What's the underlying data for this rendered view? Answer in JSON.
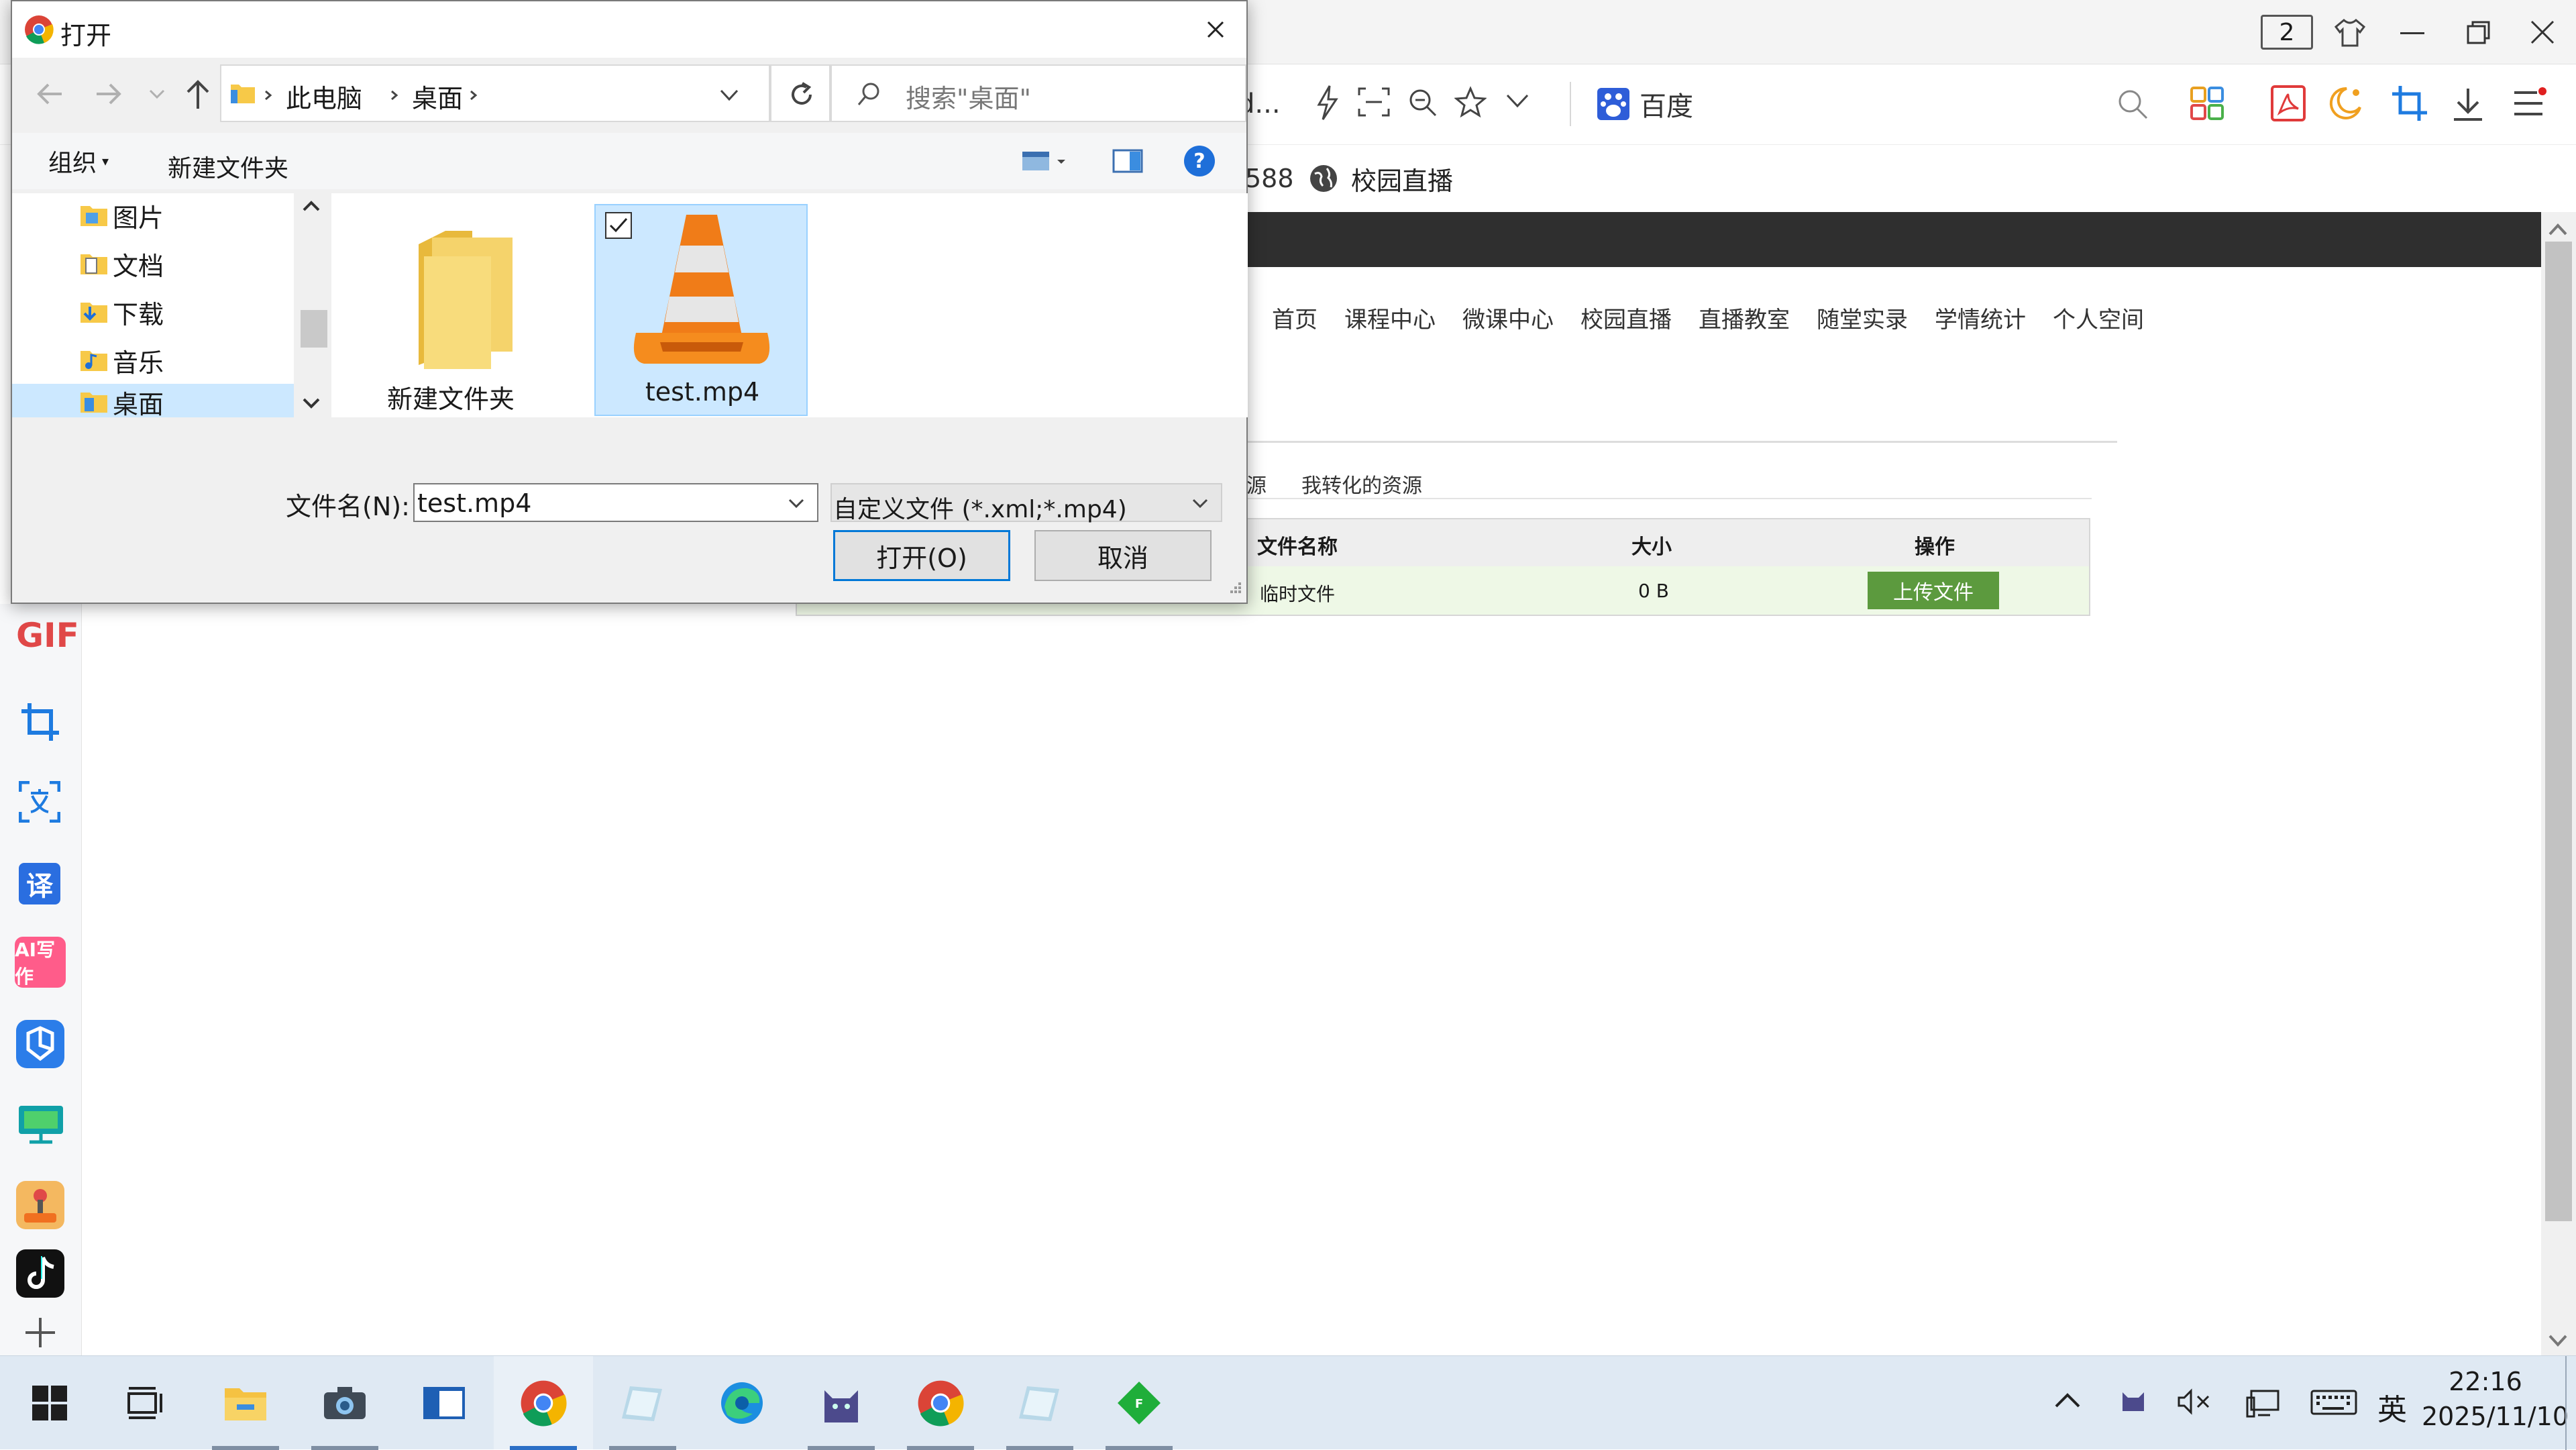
{
  "browser": {
    "tab_count": "2",
    "toolbar_trunc": "d...",
    "search_engine": "百度",
    "bookmarks": {
      "trunc_num": "588",
      "item": "校园直播"
    }
  },
  "site": {
    "nav": [
      "首页",
      "课程中心",
      "微课中心",
      "校园直播",
      "直播教室",
      "随堂实录",
      "学情统计",
      "个人空间"
    ],
    "subtabs": {
      "trunc": "源",
      "converted": "我转化的资源"
    },
    "table": {
      "headers": {
        "name": "文件名称",
        "size": "大小",
        "action": "操作"
      },
      "row": {
        "name": "临时文件",
        "size": "0 B",
        "action": "上传文件"
      }
    }
  },
  "sidebar_tools": [
    "GIF",
    "crop",
    "ocr",
    "译",
    "AI写作",
    "app",
    "screen",
    "game",
    "tiktok",
    "+"
  ],
  "dialog": {
    "title": "打开",
    "breadcrumb": [
      "此电脑",
      "桌面"
    ],
    "search_placeholder": "搜索\"桌面\"",
    "organize": "组织",
    "new_folder": "新建文件夹",
    "tree": [
      "图片",
      "文档",
      "下载",
      "音乐",
      "桌面"
    ],
    "files": [
      {
        "name": "新建文件夹",
        "kind": "folder"
      },
      {
        "name": "test.mp4",
        "kind": "video"
      }
    ],
    "filename_label": "文件名(N):",
    "filename_value": "test.mp4",
    "filetype_value": "自定义文件 (*.xml;*.mp4)",
    "open_label": "打开(O)",
    "cancel_label": "取消"
  },
  "taskbar": {
    "time": "22:16",
    "date": "2025/11/10",
    "ime": "英"
  },
  "colors": {
    "accent": "#0078d7",
    "upload_green": "#5c9a3e",
    "row_green": "#eef8e6",
    "selection": "#cce8ff"
  }
}
